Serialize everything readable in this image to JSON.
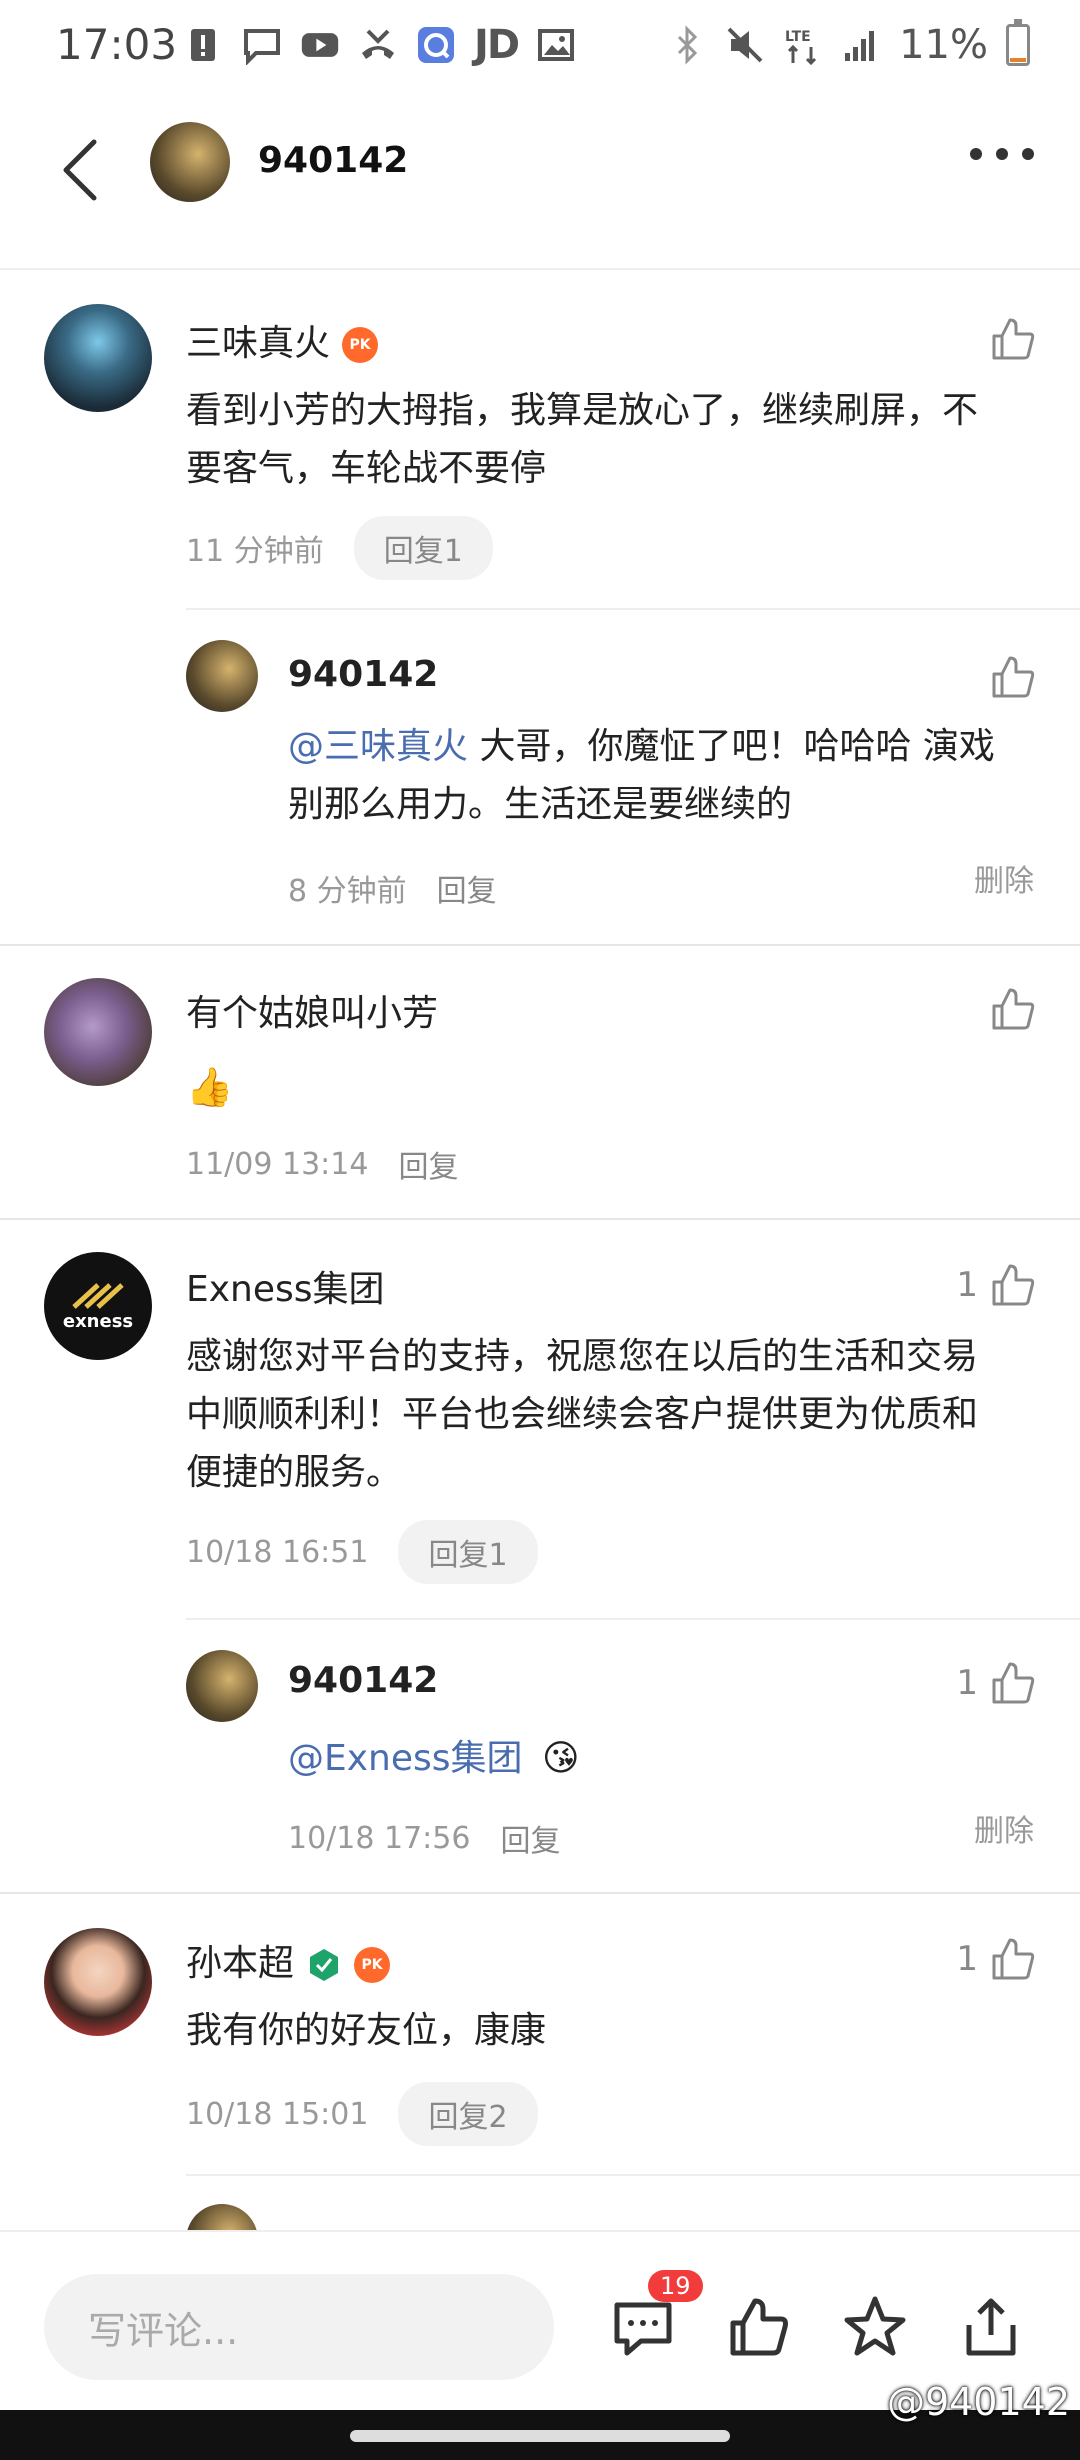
{
  "status_bar": {
    "time": "17:03",
    "jd_label": "JD",
    "battery": "11%",
    "battery_level": 0.11,
    "icons_left": [
      "notification-icon",
      "message-icon",
      "youtube-icon",
      "missed-call-icon",
      "browser-icon",
      "jd-icon",
      "image-icon"
    ],
    "icons_right": [
      "bluetooth-icon",
      "mute-icon",
      "lte-icon",
      "signal-icon",
      "battery-icon"
    ]
  },
  "header": {
    "title": "940142",
    "back_icon": "chevron-left-icon",
    "more_icon": "more-icon"
  },
  "comments": [
    {
      "name": "三味真火",
      "badge": "PK",
      "content_line1": "看到小芳的大拇指，我算是放心了，继续刷屏，不",
      "content_line2": "要客气，车轮战不要停",
      "time": "11 分钟前",
      "reply": "回复1",
      "likes": "",
      "replies": [
        {
          "name": "940142",
          "mention": "@三味真火",
          "content_line1": " 大哥，你魔怔了吧！哈哈哈 演戏",
          "content_line2": "别那么用力。生活还是要继续的",
          "time": "8 分钟前",
          "reply": "回复",
          "delete": "删除",
          "likes": ""
        }
      ]
    },
    {
      "name": "有个姑娘叫小芳",
      "content_emoji": "👍",
      "time": "11/09 13:14",
      "reply": "回复",
      "likes": ""
    },
    {
      "name": "Exness集团",
      "content_line1": "感谢您对平台的支持，祝愿您在以后的生活和交易",
      "content_line2": "中顺顺利利！平台也会继续会客户提供更为优质和",
      "content_line3": "便捷的服务。",
      "time": "10/18 16:51",
      "reply": "回复1",
      "likes": "1",
      "avatar_text": "exness",
      "replies": [
        {
          "name": "940142",
          "mention": "@Exness集团",
          "content_emoji": "😘",
          "time": "10/18 17:56",
          "reply": "回复",
          "delete": "删除",
          "likes": "1"
        }
      ]
    },
    {
      "name": "孙本超",
      "badge": "PK",
      "content_line1": "我有你的好友位，康康",
      "time": "10/18 15:01",
      "reply": "回复2",
      "likes": "1"
    }
  ],
  "bottom_bar": {
    "placeholder": "写评论...",
    "comment_count": "19",
    "icons": [
      "comment-icon",
      "like-icon",
      "star-icon",
      "share-icon"
    ]
  },
  "watermark": "@940142"
}
